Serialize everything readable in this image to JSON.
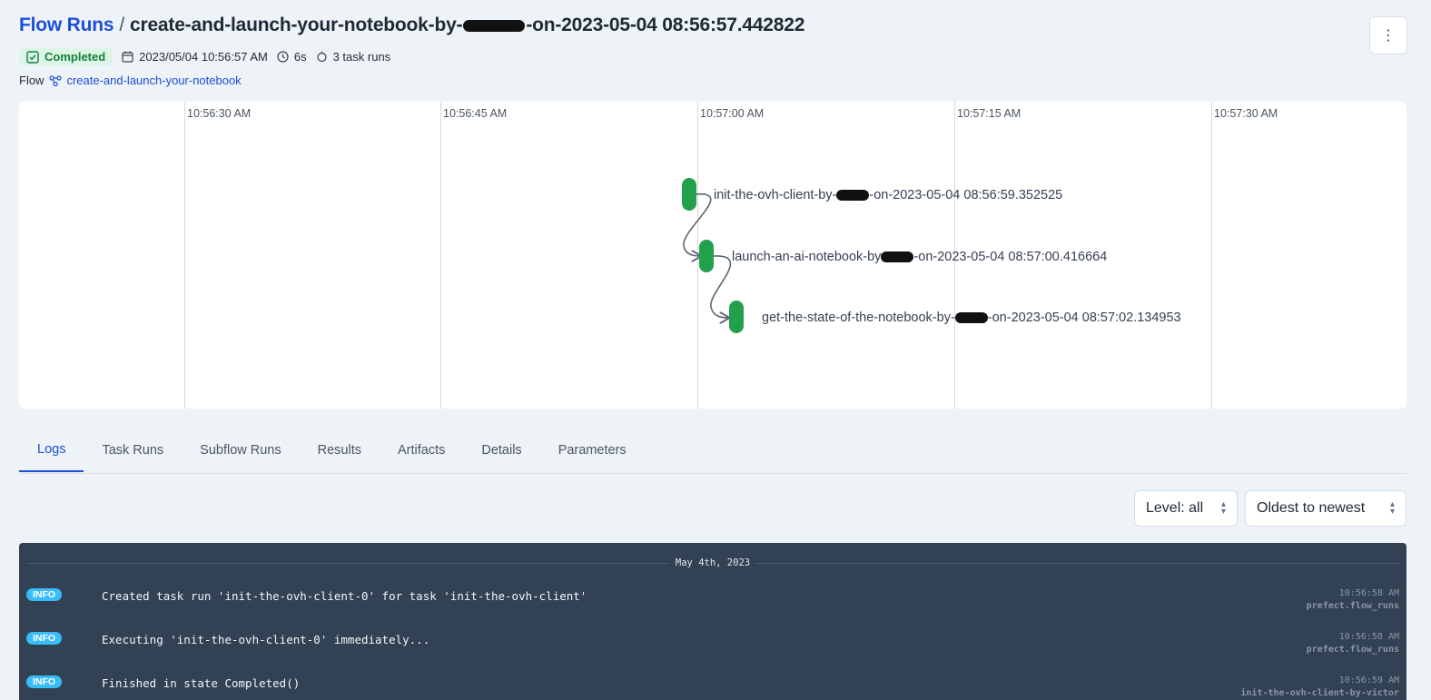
{
  "header": {
    "breadcrumb": "Flow Runs",
    "separator": "/",
    "title_prefix": "create-and-launch-your-notebook-by-",
    "title_suffix": "-on-2023-05-04 08:56:57.442822",
    "menu_icon": "⋮"
  },
  "meta": {
    "status": "Completed",
    "datetime": "2023/05/04 10:56:57 AM",
    "duration": "6s",
    "task_runs": "3 task runs"
  },
  "flow": {
    "label": "Flow",
    "name": "create-and-launch-your-notebook"
  },
  "timeline": {
    "ticks": [
      "10:56:30 AM",
      "10:56:45 AM",
      "10:57:00 AM",
      "10:57:15 AM",
      "10:57:30 AM"
    ],
    "nodes": [
      {
        "prefix": "init-the-ovh-client-by-",
        "suffix": "-on-2023-05-04 08:56:59.352525"
      },
      {
        "prefix": "launch-an-ai-notebook-by",
        "suffix": "-on-2023-05-04 08:57:00.416664"
      },
      {
        "prefix": "get-the-state-of-the-notebook-by-",
        "suffix": "-on-2023-05-04 08:57:02.134953"
      }
    ],
    "node_color": "#22a04b"
  },
  "tabs": [
    "Logs",
    "Task Runs",
    "Subflow Runs",
    "Results",
    "Artifacts",
    "Details",
    "Parameters"
  ],
  "filters": {
    "level": "Level: all",
    "order": "Oldest to newest"
  },
  "logs": {
    "date": "May 4th, 2023",
    "rows": [
      {
        "level": "INFO",
        "message": "Created task run 'init-the-ovh-client-0' for task 'init-the-ovh-client'",
        "time": "10:56:58 AM",
        "source": "prefect.flow_runs"
      },
      {
        "level": "INFO",
        "message": "Executing 'init-the-ovh-client-0' immediately...",
        "time": "10:56:58 AM",
        "source": "prefect.flow_runs"
      },
      {
        "level": "INFO",
        "message": "Finished in state Completed()",
        "time": "10:56:59 AM",
        "source": "init-the-ovh-client-by-victor"
      }
    ]
  },
  "colors": {
    "accent": "#1d4ed8",
    "success": "#15803d",
    "log_bg": "#334155",
    "info_badge": "#38bdf8"
  }
}
